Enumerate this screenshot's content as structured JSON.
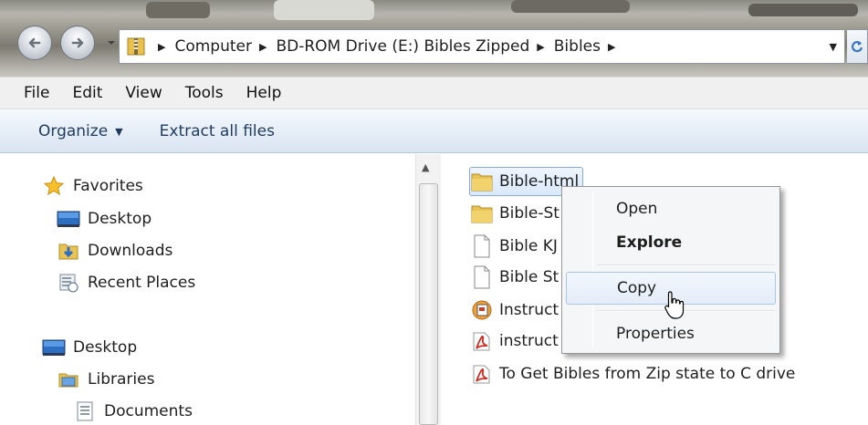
{
  "address_bar": {
    "breadcrumbs": [
      "Computer",
      "BD-ROM Drive (E:) Bibles Zipped",
      "Bibles"
    ],
    "icons": {
      "location": "folder-zip-icon",
      "back": "back-arrow-icon",
      "forward": "forward-arrow-icon"
    }
  },
  "menubar": {
    "items": [
      "File",
      "Edit",
      "View",
      "Tools",
      "Help"
    ]
  },
  "commandbar": {
    "organize": "Organize",
    "extract": "Extract all files"
  },
  "navpane": {
    "favorites": {
      "label": "Favorites",
      "items": [
        "Desktop",
        "Downloads",
        "Recent Places"
      ]
    },
    "desktop": "Desktop",
    "libraries": "Libraries",
    "documents": "Documents"
  },
  "files": [
    {
      "name": "Bible-html",
      "icon": "folder-icon"
    },
    {
      "name": "Bible-St",
      "icon": "folder-icon"
    },
    {
      "name": "Bible KJ",
      "icon": "document-icon"
    },
    {
      "name": "Bible St",
      "icon": "document-icon"
    },
    {
      "name": "Instruct",
      "icon": "web-document-icon"
    },
    {
      "name": "instruct",
      "icon": "pdf-icon"
    },
    {
      "name": "To Get Bibles from Zip state to C drive",
      "icon": "pdf-icon"
    }
  ],
  "context_menu": {
    "items": [
      "Open",
      "Explore",
      "Copy",
      "Properties"
    ]
  },
  "colors": {
    "folder": "#e9c455",
    "selection_border": "#84acdd",
    "pdf_red": "#d02b20"
  }
}
